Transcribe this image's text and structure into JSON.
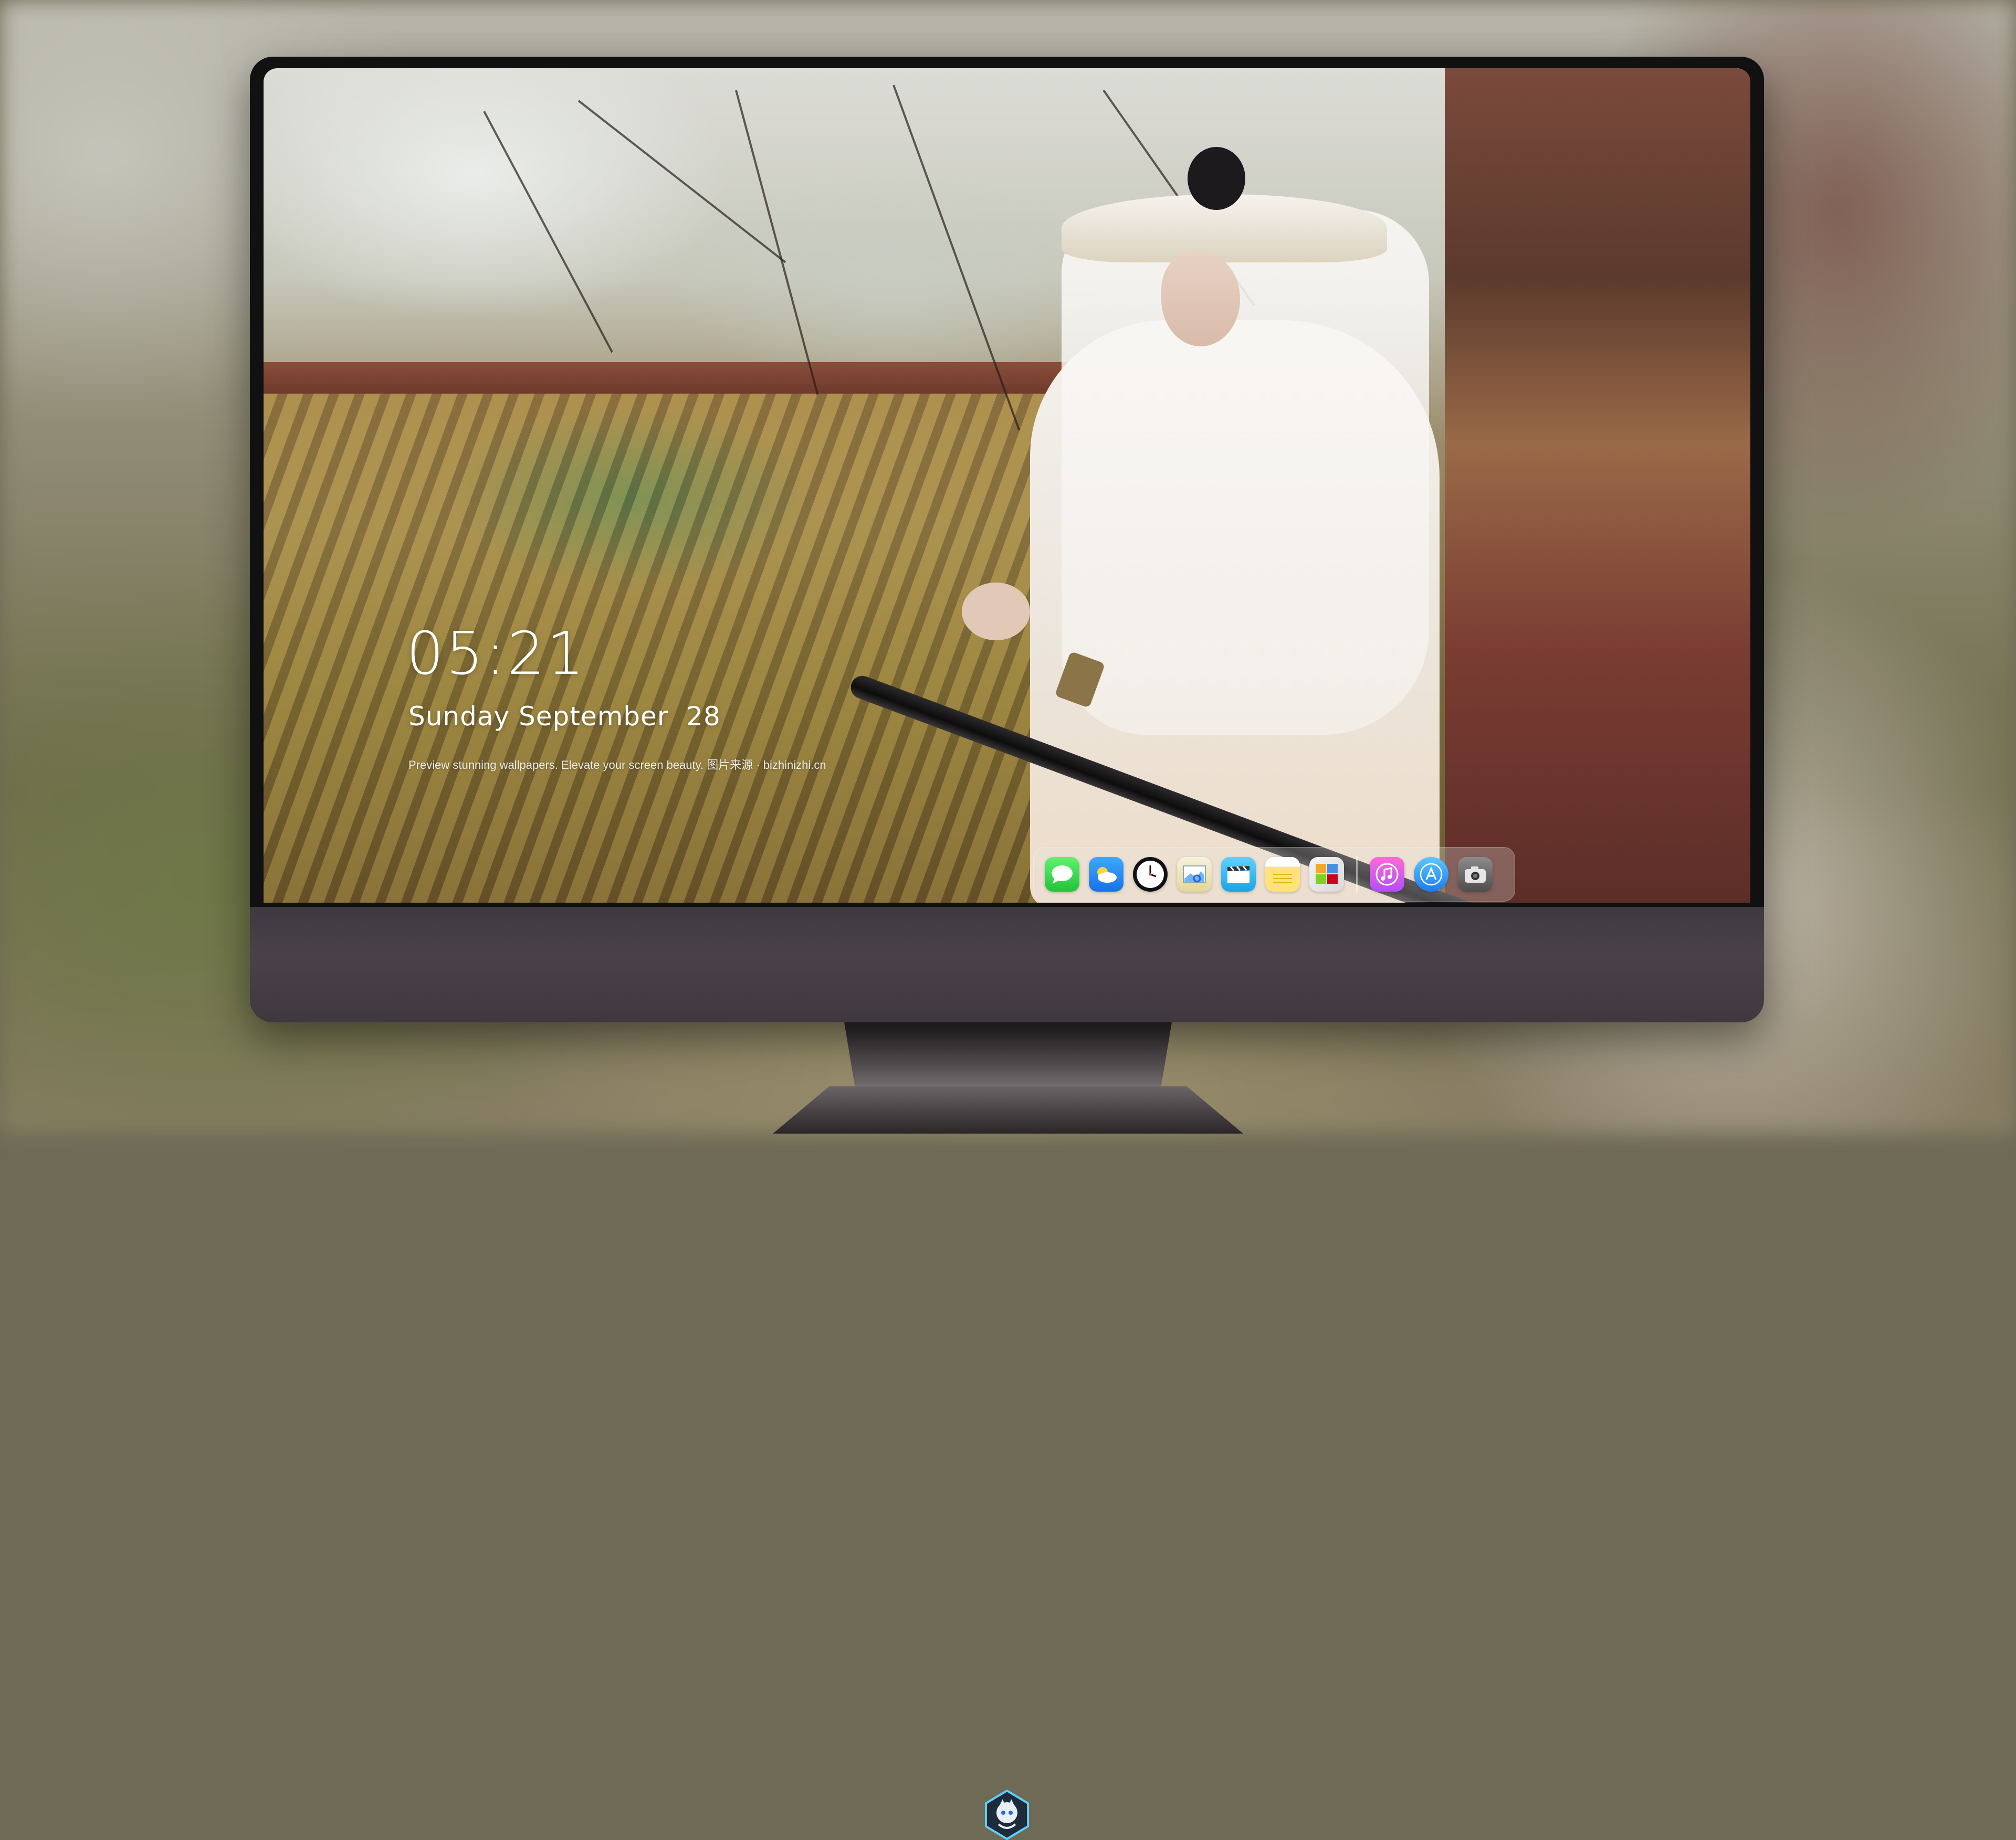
{
  "lockscreen": {
    "time": "05:21",
    "date": "Sunday September  28",
    "caption": "Preview stunning wallpapers. Elevate your screen beauty. 图片来源 · bizhinizhi.cn"
  },
  "dock": {
    "items": [
      {
        "name": "Messages",
        "icon": "messages-icon",
        "glyph": "💬"
      },
      {
        "name": "Weather",
        "icon": "weather-icon",
        "glyph": "☁"
      },
      {
        "name": "Clock",
        "icon": "clock-icon",
        "glyph": "🕐"
      },
      {
        "name": "Preview",
        "icon": "preview-icon",
        "glyph": "🗺"
      },
      {
        "name": "Clips",
        "icon": "clips-icon",
        "glyph": "🎬"
      },
      {
        "name": "Notes",
        "icon": "notes-icon",
        "glyph": "≡"
      },
      {
        "name": "Photo Booth",
        "icon": "photos-icon",
        "glyph": "🖼"
      },
      {
        "name": "iTunes",
        "icon": "music-icon",
        "glyph": "♫"
      },
      {
        "name": "App Store",
        "icon": "app-store-icon",
        "glyph": "Ⓐ"
      },
      {
        "name": "Camera",
        "icon": "camera-icon",
        "glyph": "📷"
      }
    ]
  },
  "colors": {
    "monitor_chin": "#453e45",
    "dock_background": "rgba(235,230,225,0.28)",
    "text": "#ffffff"
  }
}
